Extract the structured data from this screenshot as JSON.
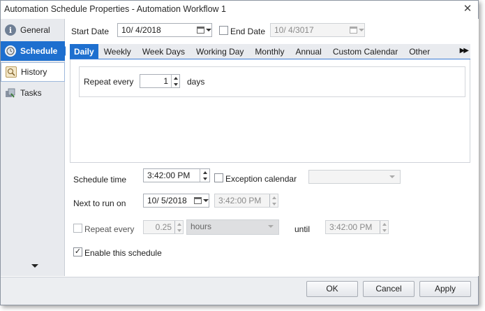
{
  "window": {
    "title": "Automation Schedule Properties - Automation Workflow 1",
    "close_glyph": "✕"
  },
  "sidebar": {
    "items": [
      {
        "label": "General",
        "icon": "info-icon"
      },
      {
        "label": "Schedule",
        "icon": "clock-icon",
        "active": true
      },
      {
        "label": "History",
        "icon": "history-icon"
      },
      {
        "label": "Tasks",
        "icon": "tasks-icon"
      }
    ]
  },
  "header": {
    "start_date_label": "Start Date",
    "start_date_value": "10/  4/2018",
    "end_date_label": "End Date",
    "end_date_checked": false,
    "end_date_value": "10/  4/3017"
  },
  "tabs": {
    "items": [
      "Daily",
      "Weekly",
      "Week Days",
      "Working Day",
      "Monthly",
      "Annual",
      "Custom Calendar",
      "Other"
    ],
    "active_index": 0,
    "scroll_glyph": "▶▶"
  },
  "daily": {
    "repeat_label": "Repeat every",
    "repeat_value": "1",
    "unit_label": "days"
  },
  "schedule": {
    "time_label": "Schedule time",
    "time_value": "3:42:00 PM",
    "exception_label": "Exception calendar",
    "exception_checked": false,
    "exception_value": "",
    "next_run_label": "Next to run on",
    "next_run_date": "10/  5/2018",
    "next_run_time": "3:42:00 PM",
    "repeat_label": "Repeat every",
    "repeat_checked": false,
    "repeat_value": "0.25",
    "repeat_unit": "hours",
    "until_label": "until",
    "until_value": "3:42:00 PM",
    "enable_label": "Enable this schedule",
    "enable_checked": true,
    "check_glyph": "✓"
  },
  "footer": {
    "ok_label": "OK",
    "cancel_label": "Cancel",
    "apply_label": "Apply"
  },
  "colors": {
    "accent": "#1e6fcf",
    "sidebar_bg": "#e8eaee",
    "tabbar_bg": "#e9ebef"
  }
}
